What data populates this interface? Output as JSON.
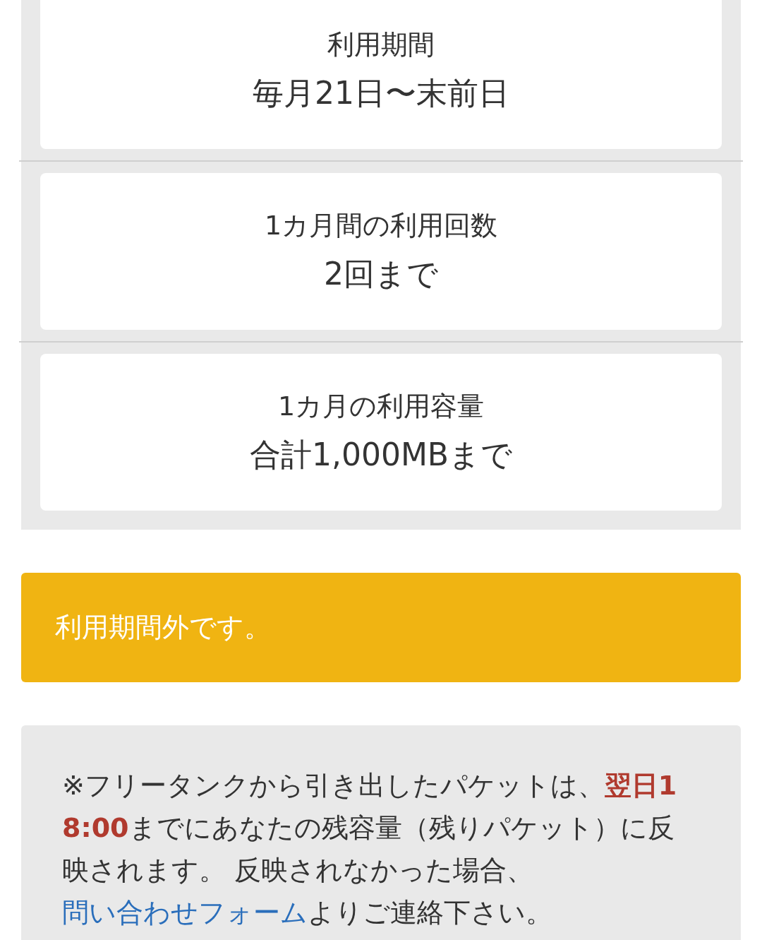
{
  "conditions": [
    {
      "label": "利用期間",
      "value": "毎月21日〜末前日"
    },
    {
      "label": "1カ月間の利用回数",
      "value": "2回まで"
    },
    {
      "label": "1カ月の利用容量",
      "value": "合計1,000MBまで"
    }
  ],
  "status_banner": {
    "text": "利用期間外です。"
  },
  "note": {
    "parts": [
      {
        "kind": "text",
        "text": "※フリータンクから引き出したパケットは、"
      },
      {
        "kind": "emphasis",
        "text": "翌日18:00"
      },
      {
        "kind": "text",
        "text": "までにあなたの残容量（残りパケット）に反映されます。 反映されなかった場合、"
      },
      {
        "kind": "link",
        "text": "問い合わせフォーム"
      },
      {
        "kind": "text",
        "text": "よりご連絡下さい。"
      }
    ]
  }
}
